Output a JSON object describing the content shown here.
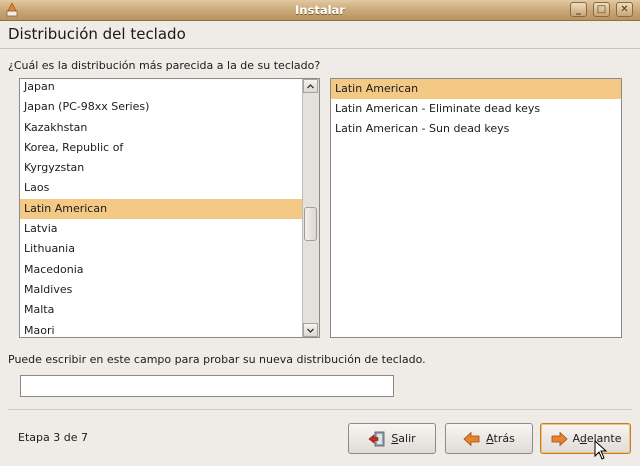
{
  "window": {
    "title": "Instalar",
    "buttons": {
      "minimize": "_",
      "maximize": "□",
      "close": "✕"
    }
  },
  "header": {
    "title": "Distribución del teclado"
  },
  "question": "¿Cuál es la distribución más parecida a la de su teclado?",
  "layouts": {
    "items": [
      "Japan",
      "Japan (PC-98xx Series)",
      "Kazakhstan",
      "Korea, Republic of",
      "Kyrgyzstan",
      "Laos",
      "Latin American",
      "Latvia",
      "Lithuania",
      "Macedonia",
      "Maldives",
      "Malta",
      "Maori"
    ],
    "selected": "Latin American"
  },
  "variants": {
    "items": [
      "Latin American",
      "Latin American - Eliminate dead keys",
      "Latin American - Sun dead keys"
    ],
    "selected": "Latin American"
  },
  "test_field": {
    "hint": "Puede escribir en este campo para probar su nueva distribución de teclado.",
    "value": "",
    "placeholder": ""
  },
  "footer": {
    "step": "Etapa 3 de 7",
    "quit": {
      "mnemonic": "S",
      "rest": "alir"
    },
    "back": {
      "mnemonic": "A",
      "rest": "trás"
    },
    "forward": {
      "pre": "A",
      "mnemonic": "d",
      "rest": "elante"
    }
  },
  "colors": {
    "selection": "#f4c985",
    "titlebar": "#c8a676",
    "background": "#efebe7",
    "arrow_orange": "#e8832a",
    "quit_red": "#cc2a22"
  },
  "icons": {
    "quit": "exit-door-icon",
    "back": "left-arrow-icon",
    "forward": "right-arrow-icon",
    "app": "installer-icon"
  }
}
